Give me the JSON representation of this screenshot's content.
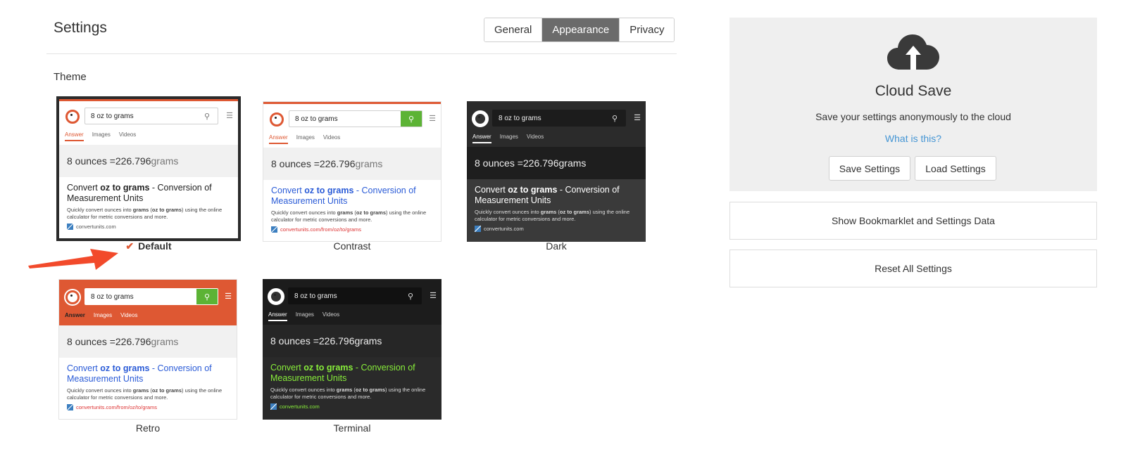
{
  "header": {
    "title": "Settings"
  },
  "tabs": [
    {
      "label": "General",
      "active": false
    },
    {
      "label": "Appearance",
      "active": true
    },
    {
      "label": "Privacy",
      "active": false
    }
  ],
  "section": {
    "theme_label": "Theme"
  },
  "preview": {
    "query": "8 oz to grams",
    "nav": [
      "Answer",
      "Images",
      "Videos"
    ],
    "answer_prefix": "8 ounces = ",
    "answer_value": "226.796",
    "answer_suffix": " grams",
    "result_title_a": "Convert ",
    "result_title_b": "oz to grams",
    "result_title_c": " - Conversion of Measurement Units",
    "snippet_a": "Quickly convert ounces into ",
    "snippet_b": "grams",
    "snippet_c": " (",
    "snippet_d": "oz to grams",
    "snippet_e": ") using the online calculator for metric conversions and more.",
    "url_short": "convertunits.com",
    "url_long": "convertunits.com/from/oz/to/grams"
  },
  "themes": [
    {
      "name": "Default",
      "selected": true
    },
    {
      "name": "Contrast",
      "selected": false
    },
    {
      "name": "Dark",
      "selected": false
    },
    {
      "name": "Retro",
      "selected": false
    },
    {
      "name": "Terminal",
      "selected": false
    }
  ],
  "selected_check": "✔",
  "cloud": {
    "title": "Cloud Save",
    "subtitle": "Save your settings anonymously to the cloud",
    "link": "What is this?",
    "save_label": "Save Settings",
    "load_label": "Load Settings"
  },
  "actions": {
    "bookmarklet_label": "Show Bookmarklet and Settings Data",
    "reset_label": "Reset All Settings"
  },
  "colors": {
    "accent": "#de5833",
    "link": "#4495d4",
    "tab_active_bg": "#6b6b6b",
    "arrow": "#f24a2b",
    "result_link_blue": "#2a5bd7",
    "terminal_green": "#88ee3a"
  },
  "icons": {
    "cloud": "cloud-upload-icon",
    "search": "search-icon",
    "menu": "hamburger-menu-icon",
    "check": "checkmark-icon"
  }
}
